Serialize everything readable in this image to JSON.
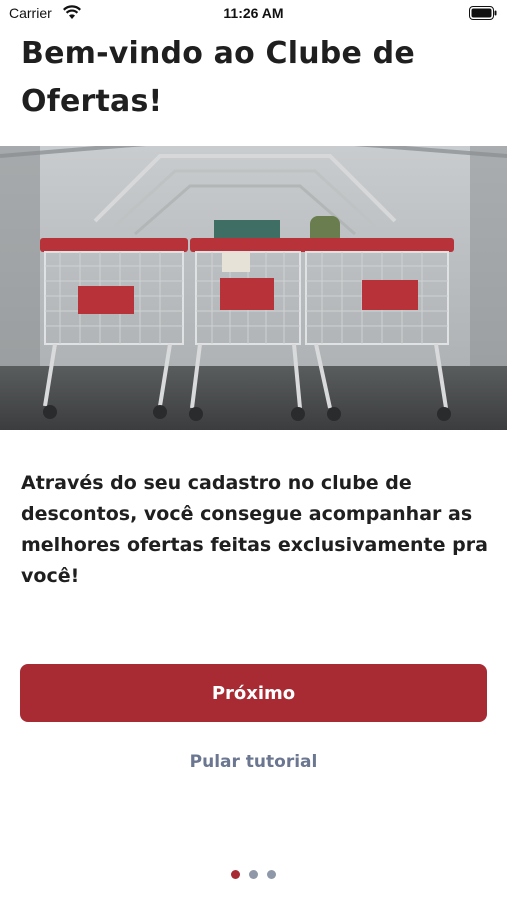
{
  "status_bar": {
    "carrier": "Carrier",
    "time": "11:26 AM"
  },
  "onboarding": {
    "title": "Bem-vindo ao Clube de Ofertas!",
    "hero_image": "shopping-carts-photo",
    "description": "Através do seu cadastro no clube de descontos, você consegue acompanhar as melhores ofertas feitas exclusivamente pra você!",
    "next_label": "Próximo",
    "skip_label": "Pular tutorial",
    "page_count": 3,
    "current_page": 1
  },
  "colors": {
    "accent": "#a82a33",
    "link": "#6b7690",
    "text": "#1f1f1f",
    "dot_inactive": "#8f98a8"
  }
}
